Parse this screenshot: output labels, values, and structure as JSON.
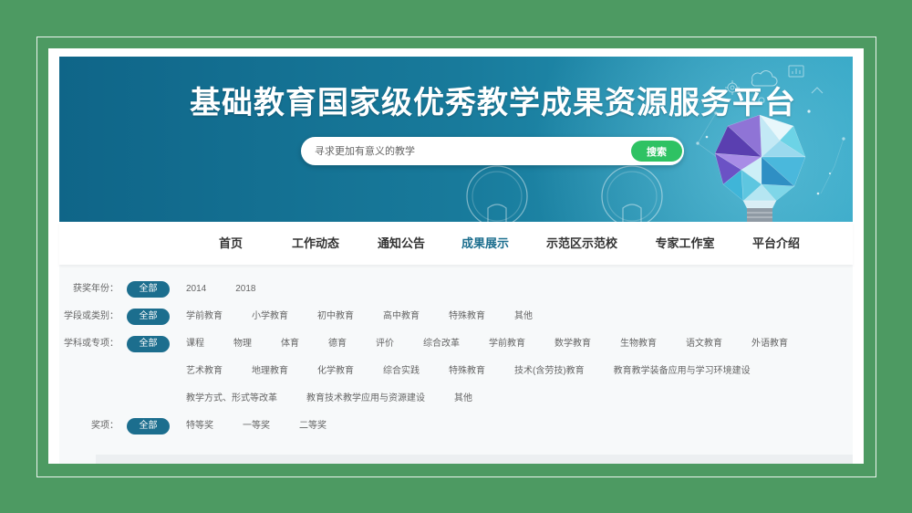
{
  "colors": {
    "page_background": "#4d9a62",
    "accent": "#1c6e8e",
    "search_button": "#2ec263"
  },
  "banner": {
    "title": "基础教育国家级优秀教学成果资源服务平台",
    "search_placeholder": "寻求更加有意义的教学",
    "search_button": "搜索",
    "decorations": [
      "lightbulb-outline-icon",
      "lightbulb-outline-icon",
      "polygon-lightbulb-icon",
      "cloud-icon",
      "gear-icon",
      "chart-icon"
    ]
  },
  "nav": {
    "items": [
      {
        "label": "首页"
      },
      {
        "label": "工作动态"
      },
      {
        "label": "通知公告"
      },
      {
        "label": "成果展示",
        "active": true
      },
      {
        "label": "示范区示范校"
      },
      {
        "label": "专家工作室"
      },
      {
        "label": "平台介绍"
      }
    ]
  },
  "filters": [
    {
      "label": "获奖年份：",
      "all": "全部",
      "options": [
        "2014",
        "2018"
      ]
    },
    {
      "label": "学段或类别：",
      "all": "全部",
      "options": [
        "学前教育",
        "小学教育",
        "初中教育",
        "高中教育",
        "特殊教育",
        "其他"
      ]
    },
    {
      "label": "学科或专项：",
      "all": "全部",
      "options": [
        "课程",
        "物理",
        "体育",
        "德育",
        "评价",
        "综合改革",
        "学前教育",
        "数学教育",
        "生物教育",
        "语文教育",
        "外语教育",
        "艺术教育",
        "地理教育",
        "化学教育",
        "综合实践",
        "特殊教育",
        "技术(含劳技)教育",
        "教育教学装备应用与学习环境建设",
        "教学方式、形式等改革",
        "教育技术教学应用与资源建设",
        "其他"
      ]
    },
    {
      "label": "奖项：",
      "all": "全部",
      "options": [
        "特等奖",
        "一等奖",
        "二等奖"
      ]
    }
  ]
}
